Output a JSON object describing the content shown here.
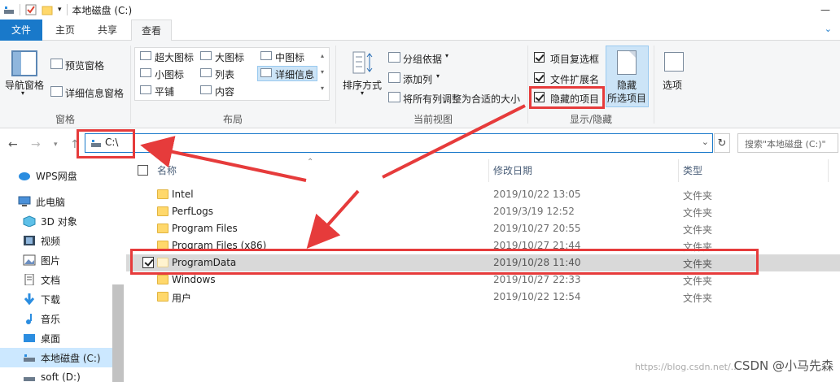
{
  "titlebar": {
    "title": "本地磁盘 (C:)",
    "minimize": "—",
    "close": "✕"
  },
  "tabs": {
    "file": "文件",
    "home": "主页",
    "share": "共享",
    "view": "查看"
  },
  "ribbon": {
    "panes": {
      "nav_pane": "导航窗格",
      "preview_pane": "预览窗格",
      "details_pane": "详细信息窗格",
      "label": "窗格"
    },
    "layout": {
      "extra_large": "超大图标",
      "large": "大图标",
      "medium": "中图标",
      "small": "小图标",
      "list": "列表",
      "details": "详细信息",
      "tiles": "平铺",
      "content": "内容",
      "label": "布局"
    },
    "current_view": {
      "sort_by": "排序方式",
      "group_by": "分组依据",
      "add_column": "添加列",
      "size_all": "将所有列调整为合适的大小",
      "label": "当前视图"
    },
    "show_hide": {
      "item_checkboxes": "项目复选框",
      "file_extensions": "文件扩展名",
      "hidden_items": "隐藏的项目",
      "hide_selected_1": "隐藏",
      "hide_selected_2": "所选项目",
      "label": "显示/隐藏"
    },
    "options": "选项"
  },
  "address": {
    "path": "C:\\",
    "search_placeholder": "搜索\"本地磁盘 (C:)\""
  },
  "sidebar": {
    "items": [
      {
        "label": "WPS网盘",
        "icon": "cloud-icon"
      },
      {
        "label": "此电脑",
        "icon": "computer-icon"
      },
      {
        "label": "3D 对象",
        "icon": "3d-objects-icon"
      },
      {
        "label": "视频",
        "icon": "video-icon"
      },
      {
        "label": "图片",
        "icon": "pictures-icon"
      },
      {
        "label": "文档",
        "icon": "documents-icon"
      },
      {
        "label": "下载",
        "icon": "download-icon"
      },
      {
        "label": "音乐",
        "icon": "music-icon"
      },
      {
        "label": "桌面",
        "icon": "desktop-icon"
      },
      {
        "label": "本地磁盘 (C:)",
        "icon": "drive-icon"
      },
      {
        "label": "soft (D:)",
        "icon": "drive-icon"
      }
    ]
  },
  "list": {
    "columns": {
      "name": "名称",
      "modified": "修改日期",
      "type": "类型"
    },
    "rows": [
      {
        "name": "Intel",
        "date": "2019/10/22 13:05",
        "type": "文件夹"
      },
      {
        "name": "PerfLogs",
        "date": "2019/3/19 12:52",
        "type": "文件夹"
      },
      {
        "name": "Program Files",
        "date": "2019/10/27 20:55",
        "type": "文件夹"
      },
      {
        "name": "Program Files (x86)",
        "date": "2019/10/27 21:44",
        "type": "文件夹"
      },
      {
        "name": "ProgramData",
        "date": "2019/10/28 11:40",
        "type": "文件夹"
      },
      {
        "name": "Windows",
        "date": "2019/10/27 22:33",
        "type": "文件夹"
      },
      {
        "name": "用户",
        "date": "2019/10/22 12:54",
        "type": "文件夹"
      }
    ]
  },
  "watermark": {
    "url": "https://blog.csdn.net/...",
    "text": "CSDN @小马先森"
  },
  "colors": {
    "accent": "#1979ca",
    "annotation": "#e63b3b",
    "selected_row": "#d9d9d9"
  }
}
